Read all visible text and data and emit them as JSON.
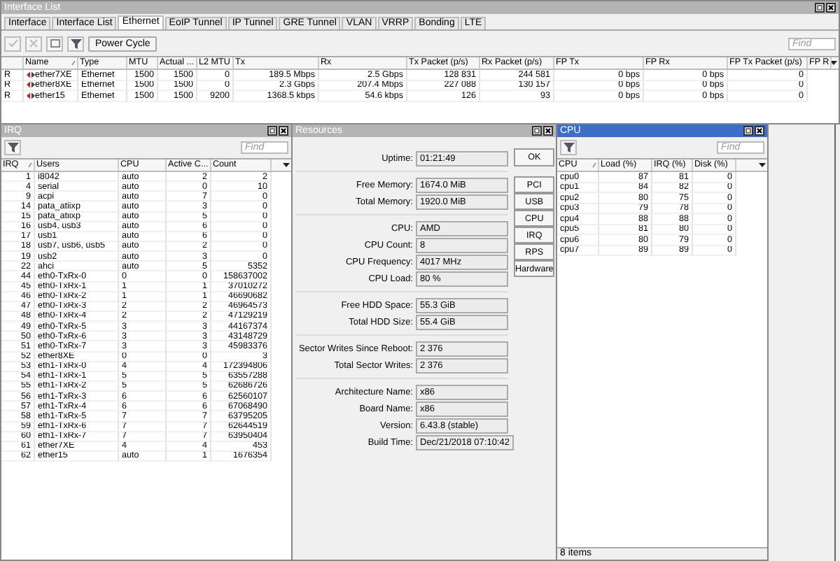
{
  "interface_window": {
    "title": "Interface List",
    "active": false,
    "tabs": [
      {
        "label": "Interface",
        "selected": false
      },
      {
        "label": "Interface List",
        "selected": false
      },
      {
        "label": "Ethernet",
        "selected": true
      },
      {
        "label": "EoIP Tunnel",
        "selected": false
      },
      {
        "label": "IP Tunnel",
        "selected": false
      },
      {
        "label": "GRE Tunnel",
        "selected": false
      },
      {
        "label": "VLAN",
        "selected": false
      },
      {
        "label": "VRRP",
        "selected": false
      },
      {
        "label": "Bonding",
        "selected": false
      },
      {
        "label": "LTE",
        "selected": false
      }
    ],
    "toolbar": {
      "button": "Power Cycle",
      "find_placeholder": "Find"
    },
    "table": {
      "columns": [
        {
          "label": "Name",
          "sorted": true
        },
        {
          "label": "Type",
          "sorted": false
        },
        {
          "label": "MTU",
          "sorted": false
        },
        {
          "label": "Actual ...",
          "sorted": false
        },
        {
          "label": "L2 MTU",
          "sorted": false
        },
        {
          "label": "Tx",
          "sorted": false
        },
        {
          "label": "Rx",
          "sorted": false
        },
        {
          "label": "Tx Packet (p/s)",
          "sorted": false
        },
        {
          "label": "Rx Packet (p/s)",
          "sorted": false
        },
        {
          "label": "FP Tx",
          "sorted": false
        },
        {
          "label": "FP Rx",
          "sorted": false
        },
        {
          "label": "FP Tx Packet (p/s)",
          "sorted": false
        },
        {
          "label": "FP R",
          "sorted": false
        }
      ],
      "rows": [
        {
          "flag": "R",
          "cells": [
            "ether7XE",
            "Ethernet",
            "1500",
            "1500",
            "0",
            "189.5 Mbps",
            "2.5 Gbps",
            "128 831",
            "244 581",
            "0 bps",
            "0 bps",
            "0"
          ]
        },
        {
          "flag": "R",
          "cells": [
            "ether8XE",
            "Ethernet",
            "1500",
            "1500",
            "0",
            "2.3 Gbps",
            "207.4 Mbps",
            "227 088",
            "130 157",
            "0 bps",
            "0 bps",
            "0"
          ]
        },
        {
          "flag": "R",
          "cells": [
            "ether15",
            "Ethernet",
            "1500",
            "1500",
            "9200",
            "1368.5 kbps",
            "54.6 kbps",
            "126",
            "93",
            "0 bps",
            "0 bps",
            "0"
          ]
        }
      ]
    }
  },
  "irq_window": {
    "title": "IRQ",
    "active": false,
    "find_placeholder": "Find",
    "table": {
      "columns": [
        {
          "label": "IRQ",
          "sorted": true
        },
        {
          "label": "Users",
          "sorted": false
        },
        {
          "label": "CPU",
          "sorted": false
        },
        {
          "label": "Active C...",
          "sorted": false
        },
        {
          "label": "Count",
          "sorted": false
        }
      ],
      "rows": [
        {
          "cells": [
            "1",
            "i8042",
            "auto",
            "2",
            "2"
          ]
        },
        {
          "cells": [
            "4",
            "serial",
            "auto",
            "0",
            "10"
          ]
        },
        {
          "cells": [
            "9",
            "acpi",
            "auto",
            "7",
            "0"
          ]
        },
        {
          "cells": [
            "14",
            "pata_atiixp",
            "auto",
            "3",
            "0"
          ]
        },
        {
          "cells": [
            "15",
            "pata_atiixp",
            "auto",
            "5",
            "0"
          ]
        },
        {
          "cells": [
            "16",
            "usb4, usb3",
            "auto",
            "6",
            "0"
          ]
        },
        {
          "cells": [
            "17",
            "usb1",
            "auto",
            "6",
            "0"
          ]
        },
        {
          "cells": [
            "18",
            "usb7, usb6, usb5",
            "auto",
            "2",
            "0"
          ]
        },
        {
          "cells": [
            "19",
            "usb2",
            "auto",
            "3",
            "0"
          ]
        },
        {
          "cells": [
            "22",
            "ahci",
            "auto",
            "5",
            "5352"
          ]
        },
        {
          "cells": [
            "44",
            "eth0-TxRx-0",
            "0",
            "0",
            "158637002"
          ]
        },
        {
          "cells": [
            "45",
            "eth0-TxRx-1",
            "1",
            "1",
            "37010272"
          ]
        },
        {
          "cells": [
            "46",
            "eth0-TxRx-2",
            "1",
            "1",
            "46690682"
          ]
        },
        {
          "cells": [
            "47",
            "eth0-TxRx-3",
            "2",
            "2",
            "46964573"
          ]
        },
        {
          "cells": [
            "48",
            "eth0-TxRx-4",
            "2",
            "2",
            "47129219"
          ]
        },
        {
          "cells": [
            "49",
            "eth0-TxRx-5",
            "3",
            "3",
            "44167374"
          ]
        },
        {
          "cells": [
            "50",
            "eth0-TxRx-6",
            "3",
            "3",
            "43148729"
          ]
        },
        {
          "cells": [
            "51",
            "eth0-TxRx-7",
            "3",
            "3",
            "45983376"
          ]
        },
        {
          "cells": [
            "52",
            "ether8XE",
            "0",
            "0",
            "3"
          ]
        },
        {
          "cells": [
            "53",
            "eth1-TxRx-0",
            "4",
            "4",
            "172394806"
          ]
        },
        {
          "cells": [
            "54",
            "eth1-TxRx-1",
            "5",
            "5",
            "63557288"
          ]
        },
        {
          "cells": [
            "55",
            "eth1-TxRx-2",
            "5",
            "5",
            "62686726"
          ]
        },
        {
          "cells": [
            "56",
            "eth1-TxRx-3",
            "6",
            "6",
            "62560107"
          ]
        },
        {
          "cells": [
            "57",
            "eth1-TxRx-4",
            "6",
            "6",
            "67068490"
          ]
        },
        {
          "cells": [
            "58",
            "eth1-TxRx-5",
            "7",
            "7",
            "63795205"
          ]
        },
        {
          "cells": [
            "59",
            "eth1-TxRx-6",
            "7",
            "7",
            "62644519"
          ]
        },
        {
          "cells": [
            "60",
            "eth1-TxRx-7",
            "7",
            "7",
            "63950404"
          ]
        },
        {
          "cells": [
            "61",
            "ether7XE",
            "4",
            "4",
            "453"
          ]
        },
        {
          "cells": [
            "62",
            "ether15",
            "auto",
            "1",
            "1676354"
          ]
        }
      ]
    }
  },
  "resources_window": {
    "title": "Resources",
    "active": false,
    "groups": [
      [
        {
          "label": "Uptime:",
          "value": "01:21:49"
        }
      ],
      [
        {
          "label": "Free Memory:",
          "value": "1674.0 MiB"
        },
        {
          "label": "Total Memory:",
          "value": "1920.0 MiB"
        }
      ],
      [
        {
          "label": "CPU:",
          "value": "AMD"
        },
        {
          "label": "CPU Count:",
          "value": "8"
        },
        {
          "label": "CPU Frequency:",
          "value": "4017 MHz"
        },
        {
          "label": "CPU Load:",
          "value": "80 %"
        }
      ],
      [
        {
          "label": "Free HDD Space:",
          "value": "55.3 GiB"
        },
        {
          "label": "Total HDD Size:",
          "value": "55.4 GiB"
        }
      ],
      [
        {
          "label": "Sector Writes Since Reboot:",
          "value": "2 376"
        },
        {
          "label": "Total Sector Writes:",
          "value": "2 376"
        }
      ],
      [
        {
          "label": "Architecture Name:",
          "value": "x86"
        },
        {
          "label": "Board Name:",
          "value": "x86"
        },
        {
          "label": "Version:",
          "value": "6.43.8 (stable)"
        },
        {
          "label": "Build Time:",
          "value": "Dec/21/2018 07:10:42"
        }
      ]
    ],
    "buttons": [
      "OK",
      "PCI",
      "USB",
      "CPU",
      "IRQ",
      "RPS",
      "Hardware"
    ]
  },
  "cpu_window": {
    "title": "CPU",
    "active": true,
    "find_placeholder": "Find",
    "table": {
      "columns": [
        {
          "label": "CPU",
          "sorted": true
        },
        {
          "label": "Load (%)",
          "sorted": false
        },
        {
          "label": "IRQ (%)",
          "sorted": false
        },
        {
          "label": "Disk (%)",
          "sorted": false
        }
      ],
      "rows": [
        {
          "cells": [
            "cpu0",
            "87",
            "81",
            "0"
          ]
        },
        {
          "cells": [
            "cpu1",
            "84",
            "82",
            "0"
          ]
        },
        {
          "cells": [
            "cpu2",
            "80",
            "75",
            "0"
          ]
        },
        {
          "cells": [
            "cpu3",
            "79",
            "78",
            "0"
          ]
        },
        {
          "cells": [
            "cpu4",
            "88",
            "88",
            "0"
          ]
        },
        {
          "cells": [
            "cpu5",
            "81",
            "80",
            "0"
          ]
        },
        {
          "cells": [
            "cpu6",
            "80",
            "79",
            "0"
          ]
        },
        {
          "cells": [
            "cpu7",
            "89",
            "89",
            "0"
          ]
        }
      ]
    },
    "status": "8 items"
  }
}
